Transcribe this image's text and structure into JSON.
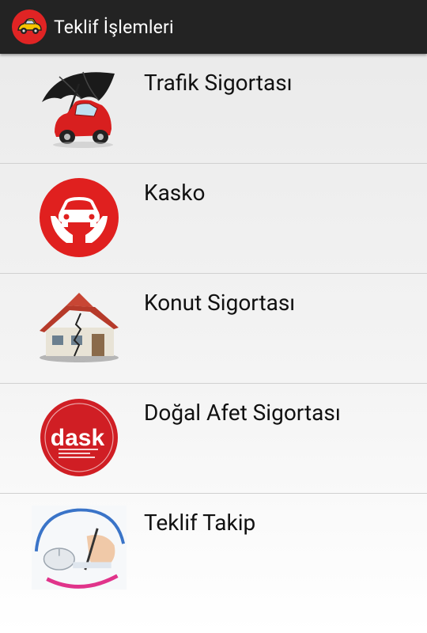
{
  "appbar": {
    "title": "Teklif İşlemleri",
    "icon": "car-logo-icon"
  },
  "menu": {
    "items": [
      {
        "label": "Trafik Sigortası",
        "icon": "umbrella-car-icon"
      },
      {
        "label": "Kasko",
        "icon": "hands-car-icon"
      },
      {
        "label": "Konut Sigortası",
        "icon": "house-crack-icon"
      },
      {
        "label": "Doğal Afet Sigortası",
        "icon": "dask-logo-icon",
        "logo_text": "dask"
      },
      {
        "label": "Teklif Takip",
        "icon": "mouse-pen-icon"
      }
    ]
  },
  "colors": {
    "appbar_bg": "#232323",
    "accent_red": "#e02020",
    "text": "#111111"
  }
}
